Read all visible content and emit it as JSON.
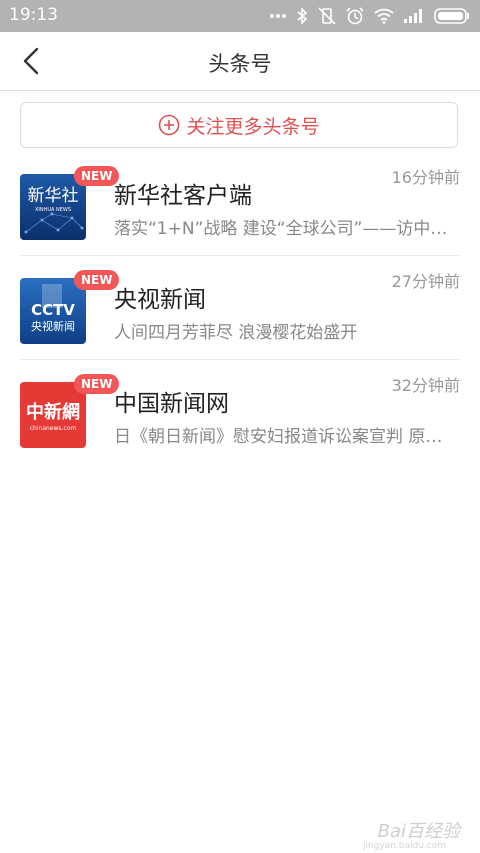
{
  "status_bar": {
    "time": "19:13",
    "icons": [
      "more-dots-icon",
      "bluetooth-icon",
      "vibrate-icon",
      "alarm-icon",
      "wifi-icon",
      "signal-icon",
      "battery-icon"
    ]
  },
  "header": {
    "title": "头条号",
    "back_icon": "chevron-left-icon"
  },
  "follow_more": {
    "label": "关注更多头条号",
    "icon": "plus-circle-icon"
  },
  "feed": [
    {
      "name": "新华社客户端",
      "time": "16分钟前",
      "snippet": "落实“1+N”战略 建设“全球公司”——访中国...",
      "badge": "NEW",
      "avatar_text": "新华社",
      "avatar_sub": "XINHUA NEWS"
    },
    {
      "name": "央视新闻",
      "time": "27分钟前",
      "snippet": "人间四月芳菲尽 浪漫樱花始盛开",
      "badge": "NEW",
      "avatar_text": "CCTV",
      "avatar_sub": "央视新闻"
    },
    {
      "name": "中国新闻网",
      "time": "32分钟前",
      "snippet": "日《朝日新闻》慰安妇报道诉讼案宣判 原告...",
      "badge": "NEW",
      "avatar_text": "中新網",
      "avatar_sub": "chinanews.com"
    }
  ],
  "watermark": {
    "text": "Bai百经验",
    "sub": "jingyan.baidu.com"
  },
  "colors": {
    "accent": "#e05252",
    "badge": "#f25656",
    "status_bar": "#b3b3b3"
  }
}
